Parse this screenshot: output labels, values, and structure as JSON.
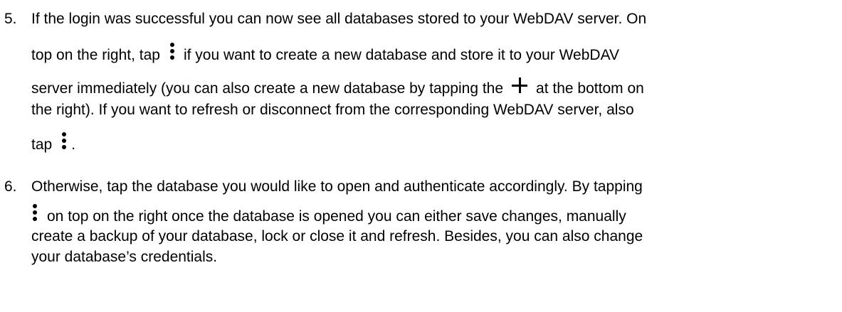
{
  "steps": [
    {
      "number": "5.",
      "lines": [
        {
          "text": "If the login was successful you can now see all databases stored to your WebDAV server. On"
        },
        {
          "before": "top on the right, tap",
          "icon": "more-vertical-icon",
          "after": "if you want to create a new database and store it to your WebDAV"
        },
        {
          "before": "server immediately (you can also create a new database by tapping the",
          "icon": "plus-icon",
          "after": "at the bottom on"
        },
        {
          "text": "the right). If you want to refresh or disconnect from the corresponding WebDAV server, also"
        },
        {
          "before": "tap",
          "icon": "more-vertical-icon",
          "after": "."
        }
      ]
    },
    {
      "number": "6.",
      "lines": [
        {
          "text": "Otherwise, tap the database you would like to open and authenticate accordingly. By tapping"
        },
        {
          "icon": "more-vertical-icon",
          "after": "on top on the right once the database is opened you can either save changes, manually"
        },
        {
          "text": "create a backup of your database, lock or close it and refresh. Besides, you can also change"
        },
        {
          "text": "your database’s credentials."
        }
      ]
    }
  ]
}
